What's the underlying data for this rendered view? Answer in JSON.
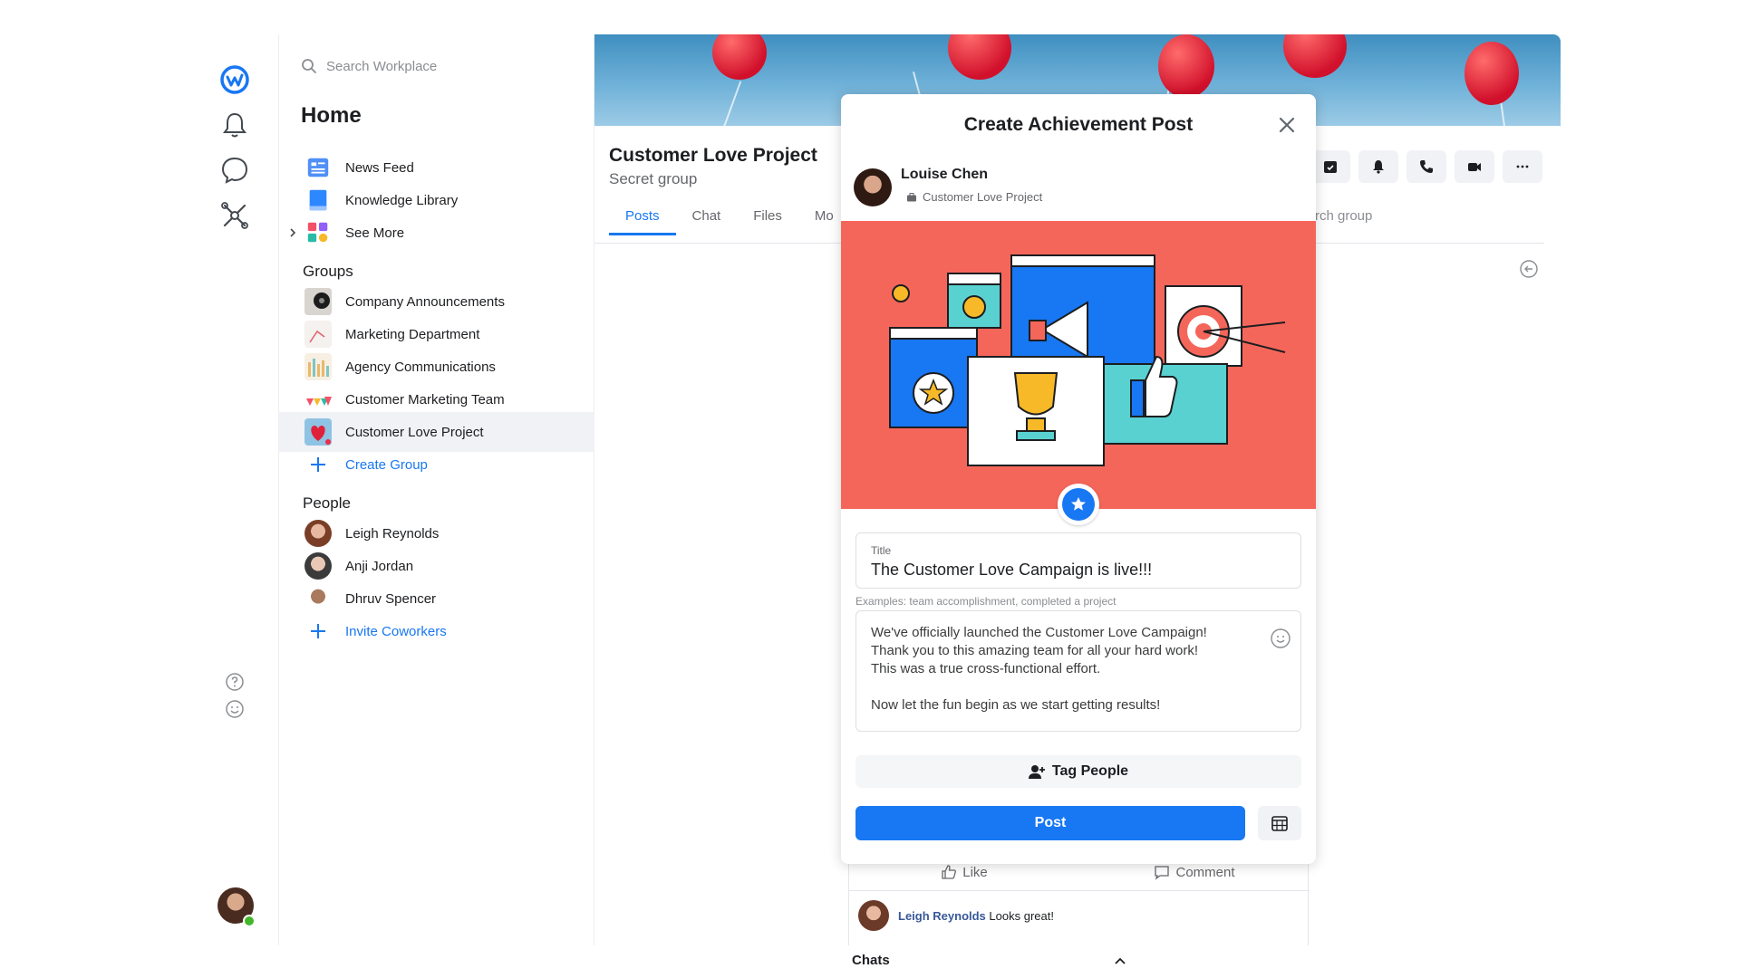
{
  "search": {
    "placeholder": "Search Workplace"
  },
  "sidebar": {
    "title": "Home",
    "shortcuts": [
      {
        "label": "News Feed",
        "icon": "news-feed-icon"
      },
      {
        "label": "Knowledge Library",
        "icon": "book-icon"
      },
      {
        "label": "See More",
        "icon": "apps-icon"
      }
    ],
    "groups_title": "Groups",
    "groups": [
      {
        "label": "Company Announcements"
      },
      {
        "label": "Marketing Department"
      },
      {
        "label": "Agency Communications"
      },
      {
        "label": "Customer Marketing Team"
      },
      {
        "label": "Customer Love Project"
      }
    ],
    "create_group": "Create Group",
    "people_title": "People",
    "people": [
      {
        "label": "Leigh Reynolds"
      },
      {
        "label": "Anji Jordan"
      },
      {
        "label": "Dhruv Spencer"
      }
    ],
    "invite": "Invite Coworkers"
  },
  "group": {
    "name": "Customer Love Project",
    "privacy": "Secret group",
    "tabs": [
      "Posts",
      "Chat",
      "Files",
      "Mo"
    ],
    "search_partial": "rch group"
  },
  "modal": {
    "title": "Create Achievement Post",
    "author": "Louise Chen",
    "group": "Customer Love Project",
    "title_label": "Title",
    "title_value": "The Customer Love Campaign is live!!!",
    "hint": "Examples: team accomplishment, completed a project",
    "body": "We've officially launched the Customer Love Campaign!\nThank you to this amazing team for all your hard work!\nThis was a true cross-functional effort.\n\nNow let the fun begin as we start getting results!",
    "tag_people": "Tag People",
    "post": "Post"
  },
  "feed": {
    "like": "Like",
    "comment": "Comment",
    "comment_author": "Leigh Reynolds",
    "comment_text": " Looks great!"
  },
  "chats": {
    "label": "Chats"
  },
  "colors": {
    "accent": "#1877f2",
    "hero": "#f5665a",
    "online": "#42b72a"
  }
}
